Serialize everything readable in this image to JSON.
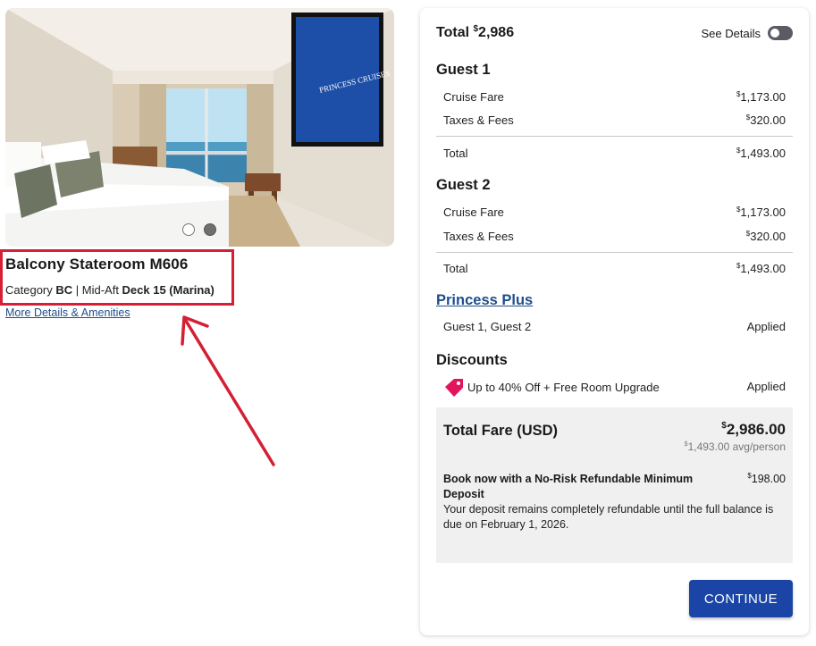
{
  "stateroom": {
    "photo_caption": "PRINCESS CRUISES",
    "carousel_count": 2,
    "carousel_active": 1,
    "title": "Balcony Stateroom M606",
    "category_prefix": "Category ",
    "category_code": "BC",
    "separator": " | Mid-Aft ",
    "deck": "Deck 15 (Marina)",
    "more_link": "More Details & Amenities"
  },
  "summary": {
    "total_label": "Total ",
    "currency_symbol": "$",
    "total_amount": "2,986",
    "see_details": "See Details",
    "see_details_on": false
  },
  "guests": [
    {
      "title": "Guest 1",
      "rows": [
        {
          "label": "Cruise Fare",
          "value": "1,173.00"
        },
        {
          "label": "Taxes & Fees",
          "value": "320.00"
        }
      ],
      "total_label": "Total",
      "total_value": "1,493.00"
    },
    {
      "title": "Guest 2",
      "rows": [
        {
          "label": "Cruise Fare",
          "value": "1,173.00"
        },
        {
          "label": "Taxes & Fees",
          "value": "320.00"
        }
      ],
      "total_label": "Total",
      "total_value": "1,493.00"
    }
  ],
  "princess_plus": {
    "title": "Princess Plus",
    "guests": "Guest 1, Guest 2",
    "status": "Applied"
  },
  "discounts": {
    "title": "Discounts",
    "icon": "price-tag-icon",
    "label": "Up to 40% Off + Free Room Upgrade",
    "status": "Applied"
  },
  "fare": {
    "title": "Total Fare (USD)",
    "amount": "2,986.00",
    "avg": "1,493.00 avg/person",
    "deposit_title": "Book now with a No-Risk Refundable Minimum Deposit",
    "deposit_amount": "198.00",
    "deposit_note": "Your deposit remains completely refundable until the full balance is due on February 1, 2026."
  },
  "continue_label": "CONTINUE",
  "colors": {
    "link_blue": "#1f4e8c",
    "button_blue": "#1a45a6",
    "highlight_red": "#d41f34",
    "tag_pink": "#e2155c"
  }
}
